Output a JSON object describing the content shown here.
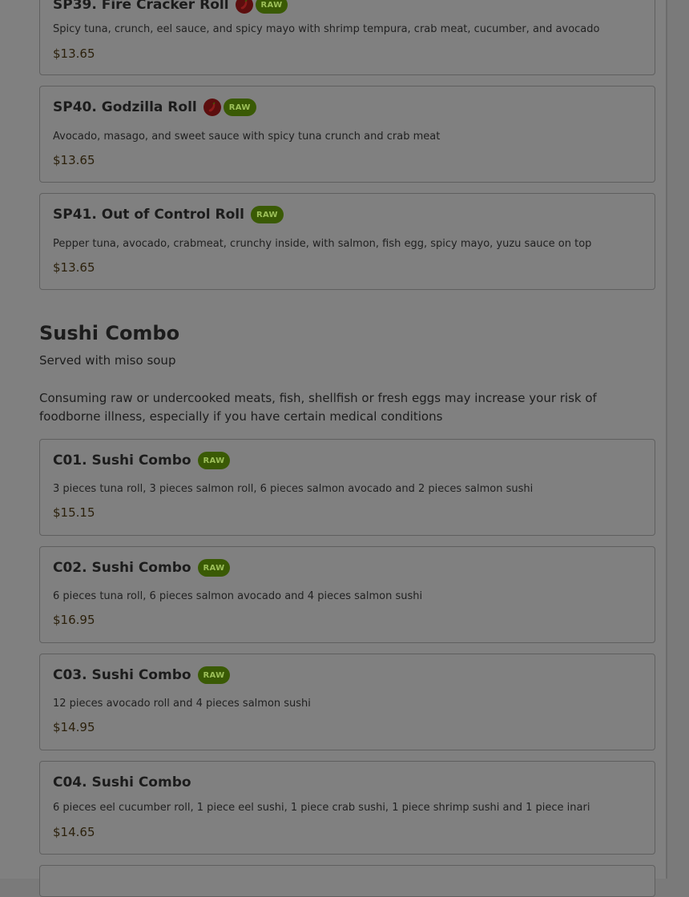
{
  "section_prev": {
    "items": [
      {
        "name": "SP39. Fire Cracker Roll",
        "spicy": true,
        "raw_label": "RAW",
        "description": "Spicy tuna, crunch, eel sauce, and spicy mayo with shrimp tempura, crab meat, cucumber, and avocado",
        "price": "$13.65"
      },
      {
        "name": "SP40. Godzilla Roll",
        "spicy": true,
        "raw_label": "RAW",
        "description": "Avocado, masago, and sweet sauce with spicy tuna crunch and crab meat",
        "price": "$13.65"
      },
      {
        "name": "SP41. Out of Control Roll",
        "spicy": false,
        "raw_label": "RAW",
        "description": "Pepper tuna, avocado, crabmeat, crunchy inside, with salmon, fish egg, spicy mayo, yuzu sauce on top",
        "price": "$13.65"
      }
    ]
  },
  "sushi_combo": {
    "title": "Sushi Combo",
    "subtitle": "Served with miso soup",
    "notice": "Consuming raw or undercooked meats, fish, shellfish or fresh eggs may increase your risk of foodborne illness, especially if you have certain medical conditions",
    "items": [
      {
        "name": "C01. Sushi Combo",
        "raw_label": "RAW",
        "description": "3 pieces tuna roll, 3 pieces salmon roll, 6 pieces salmon avocado and 2 pieces salmon sushi",
        "price": "$15.15"
      },
      {
        "name": "C02. Sushi Combo",
        "raw_label": "RAW",
        "description": "6 pieces tuna roll, 6 pieces salmon avocado and 4 pieces salmon sushi",
        "price": "$16.95"
      },
      {
        "name": "C03. Sushi Combo",
        "raw_label": "RAW",
        "description": "12 pieces avocado roll and 4 pieces salmon sushi",
        "price": "$14.95"
      },
      {
        "name": "C04. Sushi Combo",
        "description": "6 pieces eel cucumber roll, 1 piece eel sushi, 1 piece crab sushi, 1 piece shrimp sushi and 1 piece inari",
        "price": "$14.65"
      }
    ]
  },
  "colors": {
    "overlay": "#808080",
    "raw_badge_bg": "#3a5a05",
    "raw_badge_text": "#9cbf59",
    "spicy_icon_bg": "#5c0e0e",
    "price_text": "#2a1f0a"
  }
}
